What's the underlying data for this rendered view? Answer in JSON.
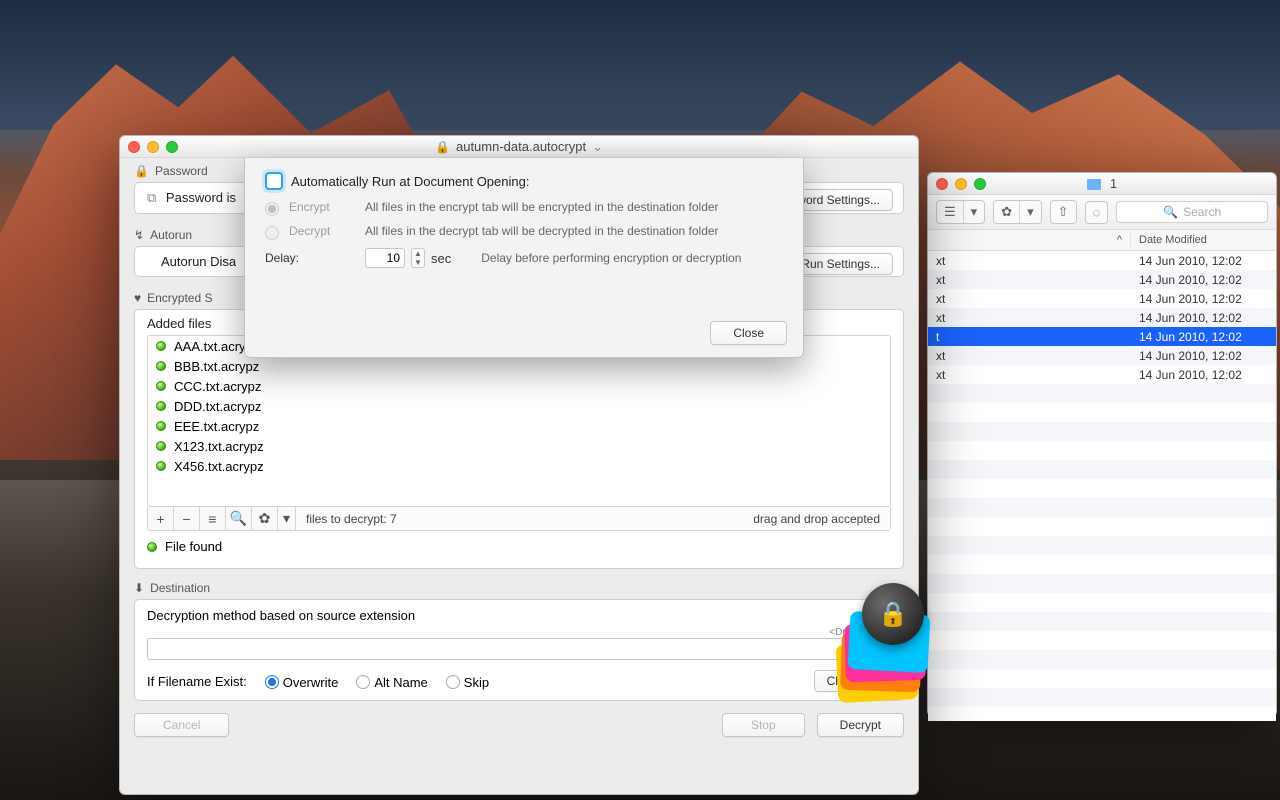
{
  "main": {
    "title": "autumn-data.autocrypt",
    "password_section": "Password",
    "password_status": "Password is",
    "password_settings_btn": "word Settings...",
    "autorun_section": "Autorun",
    "autorun_status": "Autorun Disa",
    "autorun_settings_btn": "oRun Settings...",
    "encrypted_section": "Encrypted S",
    "added_label": "Added files",
    "files": [
      "AAA.txt.acrypz",
      "BBB.txt.acrypz",
      "CCC.txt.acrypz",
      "DDD.txt.acrypz",
      "EEE.txt.acrypz",
      "X123.txt.acrypz",
      "X456.txt.acrypz"
    ],
    "files_count_label": "files to decrypt: 7",
    "dragdrop_hint": "drag and drop accepted",
    "file_found": "File found",
    "destination_section": "Destination",
    "decrypt_method": "Decryption method based on source extension",
    "dragdrop_tag": "<Drag&Drop>",
    "if_exist_label": "If Filename Exist:",
    "overwrite": "Overwrite",
    "altname": "Alt Name",
    "skip": "Skip",
    "choose_btn": "Choose...",
    "cancel_btn": "Cancel",
    "stop_btn": "Stop",
    "decrypt_btn": "Decrypt"
  },
  "sheet": {
    "headline": "Automatically Run at Document Opening:",
    "encrypt": "Encrypt",
    "encrypt_desc": "All files in the encrypt tab will be encrypted in the destination folder",
    "decrypt": "Decrypt",
    "decrypt_desc": "All files in the decrypt tab will be decrypted in the destination folder",
    "delay_label": "Delay:",
    "delay_value": "10",
    "delay_unit": "sec",
    "delay_desc": "Delay before performing encryption or decryption",
    "close": "Close"
  },
  "finder": {
    "title": "1",
    "search_placeholder": "Search",
    "col_date": "Date Modified",
    "rows": [
      {
        "name": "xt",
        "date": "14 Jun 2010, 12:02"
      },
      {
        "name": "xt",
        "date": "14 Jun 2010, 12:02"
      },
      {
        "name": "xt",
        "date": "14 Jun 2010, 12:02"
      },
      {
        "name": "xt",
        "date": "14 Jun 2010, 12:02"
      },
      {
        "name": "t",
        "date": "14 Jun 2010, 12:02"
      },
      {
        "name": "xt",
        "date": "14 Jun 2010, 12:02"
      },
      {
        "name": "xt",
        "date": "14 Jun 2010, 12:02"
      }
    ]
  }
}
